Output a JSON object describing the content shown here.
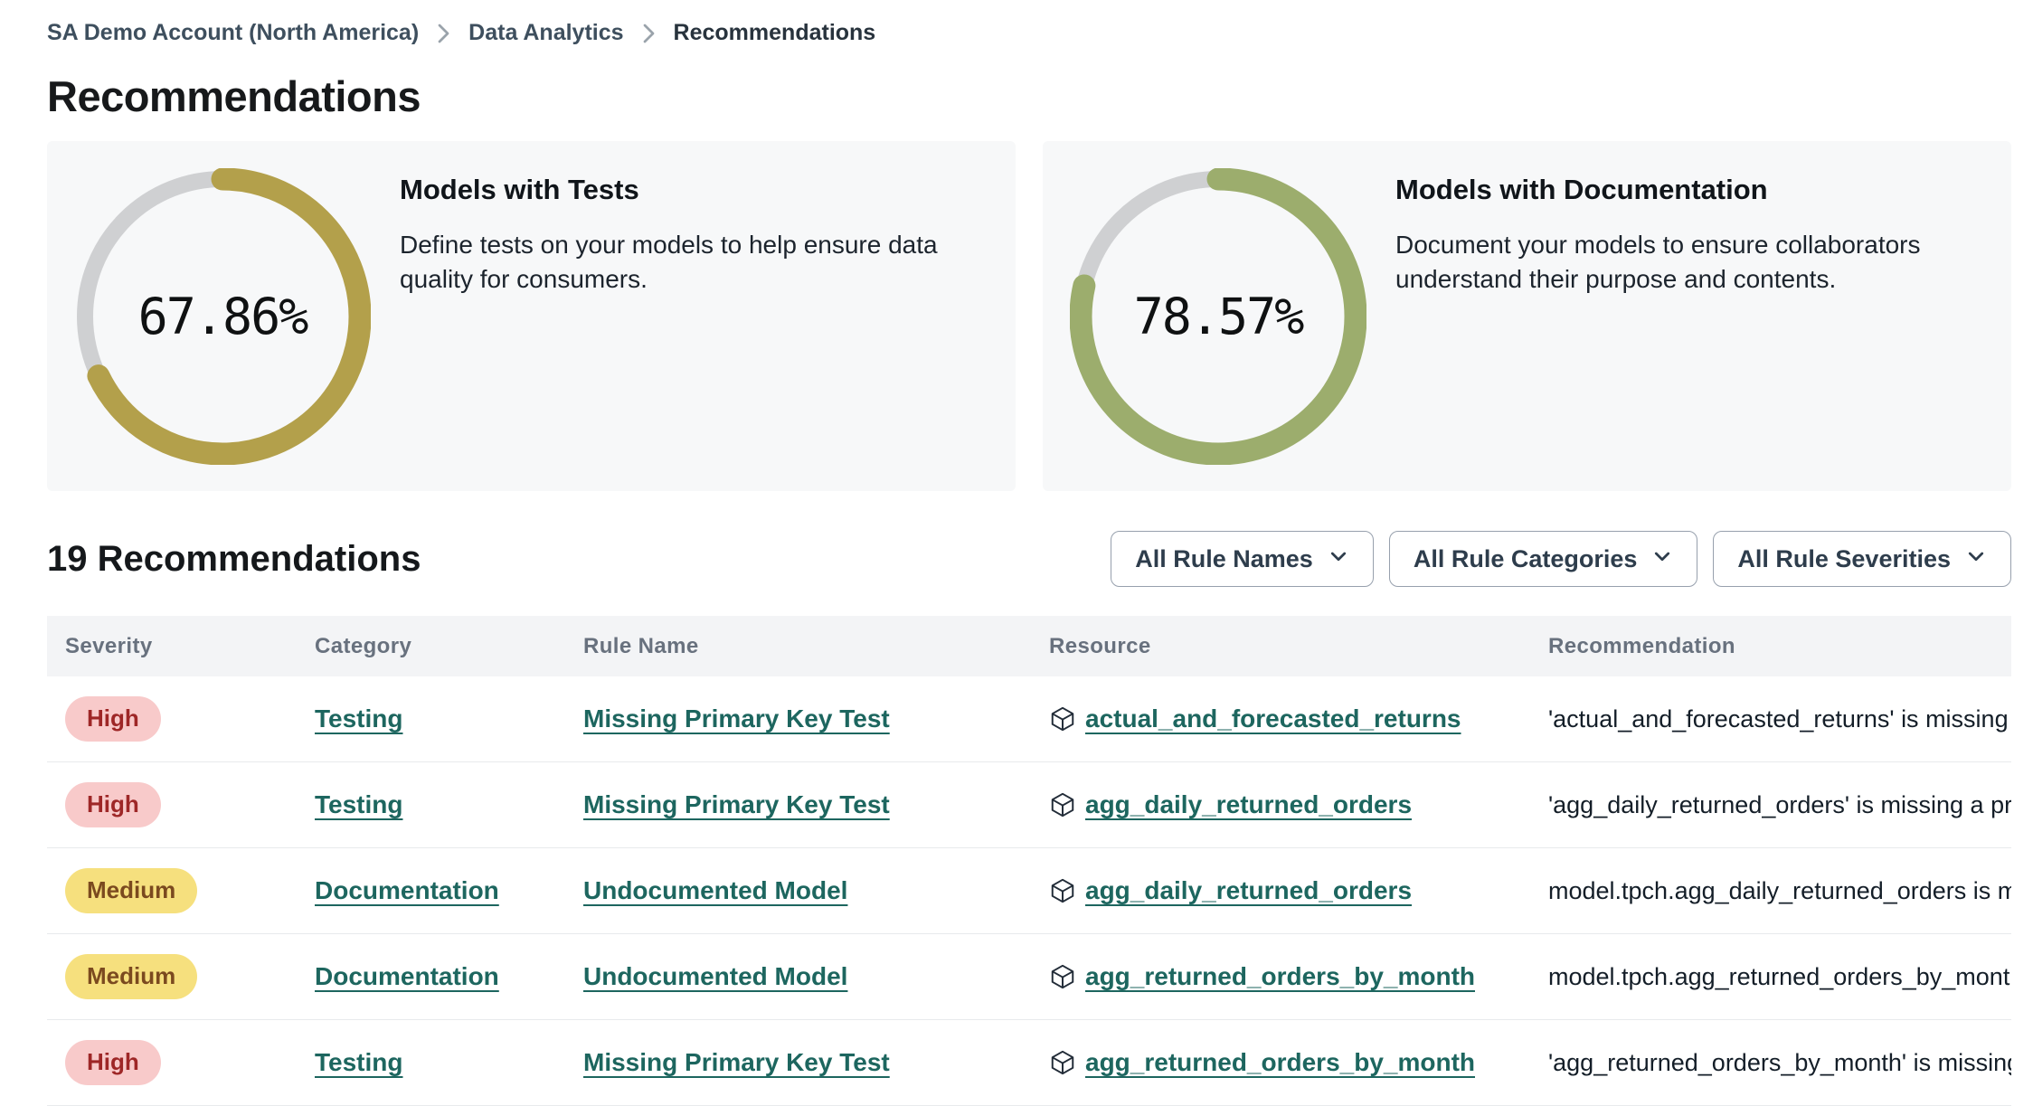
{
  "breadcrumb": {
    "items": [
      {
        "label": "SA Demo Account (North America)"
      },
      {
        "label": "Data Analytics"
      },
      {
        "label": "Recommendations"
      }
    ]
  },
  "page": {
    "title": "Recommendations"
  },
  "cards": [
    {
      "title": "Models with Tests",
      "description": "Define tests on your models to help ensure data quality for consumers.",
      "percent": 67.86,
      "percent_label": "67.86%",
      "ring_color": "#b3a04b",
      "track_color": "#cfd0d2"
    },
    {
      "title": "Models with Documentation",
      "description": "Document your models to ensure collaborators understand their purpose and contents.",
      "percent": 78.57,
      "percent_label": "78.57%",
      "ring_color": "#9cad6d",
      "track_color": "#cfd0d2"
    }
  ],
  "list_bar": {
    "count_label": "19 Recommendations"
  },
  "filters": [
    {
      "label": "All Rule Names"
    },
    {
      "label": "All Rule Categories"
    },
    {
      "label": "All Rule Severities"
    }
  ],
  "table": {
    "columns": {
      "severity": "Severity",
      "category": "Category",
      "rule_name": "Rule Name",
      "resource": "Resource",
      "recommendation": "Recommendation"
    },
    "rows": [
      {
        "severity": "High",
        "severity_level": "high",
        "category": "Testing",
        "rule_name": "Missing Primary Key Test",
        "resource": "actual_and_forecasted_returns",
        "recommendation": "'actual_and_forecasted_returns' is missing a …"
      },
      {
        "severity": "High",
        "severity_level": "high",
        "category": "Testing",
        "rule_name": "Missing Primary Key Test",
        "resource": "agg_daily_returned_orders",
        "recommendation": "'agg_daily_returned_orders' is missing a prim…"
      },
      {
        "severity": "Medium",
        "severity_level": "medium",
        "category": "Documentation",
        "rule_name": "Undocumented Model",
        "resource": "agg_daily_returned_orders",
        "recommendation": "model.tpch.agg_daily_returned_orders is mis…"
      },
      {
        "severity": "Medium",
        "severity_level": "medium",
        "category": "Documentation",
        "rule_name": "Undocumented Model",
        "resource": "agg_returned_orders_by_month",
        "recommendation": "model.tpch.agg_returned_orders_by_month …"
      },
      {
        "severity": "High",
        "severity_level": "high",
        "category": "Testing",
        "rule_name": "Missing Primary Key Test",
        "resource": "agg_returned_orders_by_month",
        "recommendation": "'agg_returned_orders_by_month' is missing …"
      }
    ]
  }
}
